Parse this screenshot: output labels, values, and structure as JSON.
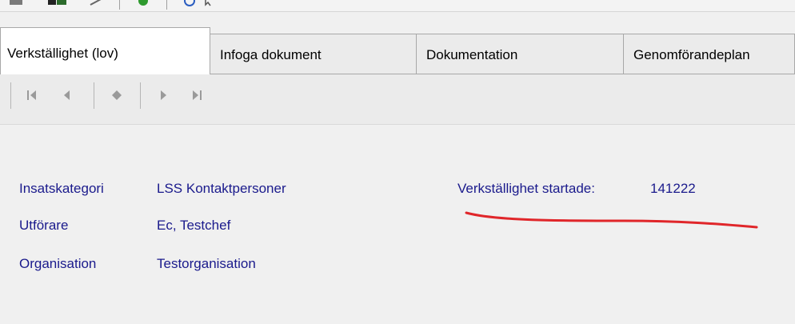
{
  "toolbar": {
    "icons": [
      "toolbar-icon-1",
      "toolbar-icon-2",
      "toolbar-icon-3",
      "toolbar-icon-4",
      "help-icon",
      "pointer-icon"
    ],
    "colors": {
      "green": "#2e9a2e",
      "blue": "#2a5dc0"
    }
  },
  "tabs": [
    {
      "label": "Verkställighet (lov)",
      "active": true
    },
    {
      "label": "Infoga dokument",
      "active": false
    },
    {
      "label": "Dokumentation",
      "active": false
    },
    {
      "label": "Genomförandeplan",
      "active": false
    }
  ],
  "navigation": {
    "buttons": [
      "first-record",
      "previous-record",
      "current-record",
      "next-record",
      "last-record"
    ]
  },
  "details": {
    "insatskategori_label": "Insatskategori",
    "insatskategori_value": "LSS Kontaktpersoner",
    "utforare_label": "Utförare",
    "utforare_value": "Ec, Testchef",
    "organisation_label": "Organisation",
    "organisation_value": "Testorganisation",
    "start_label": "Verkställighet startade:",
    "start_value": "141222"
  },
  "annotation": {
    "color": "#e0262a"
  }
}
